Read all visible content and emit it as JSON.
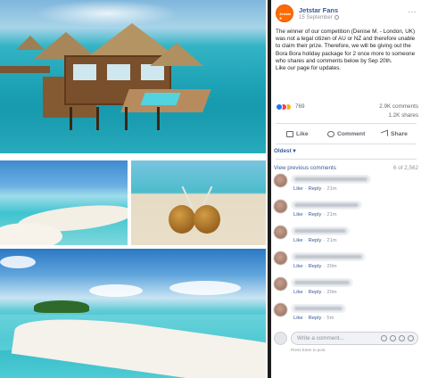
{
  "post": {
    "page_name": "Jetstar Fans",
    "avatar_text": "Jetstar ✈",
    "date": "15 September",
    "more": "···",
    "text": "The winner of our competition (Denise M. - London, UK) was not a legal citizen of AU or NZ and therefore unable to claim their prize. Therefore, we will be giving out the Bora Bora holiday package for 2 once more to someone who shares and comments below by Sep 20th.",
    "text_2": "Like our page for updates.",
    "reaction_count": "769",
    "comments_count": "2.9K comments",
    "shares_count": "1.2K shares"
  },
  "actions": {
    "like": "Like",
    "comment": "Comment",
    "share": "Share"
  },
  "comments_section": {
    "sort_label": "Oldest ▾",
    "view_previous": "View previous comments",
    "count_of": "6 of 2,562",
    "like_label": "Like",
    "reply_label": "Reply",
    "items": [
      {
        "time": "21m"
      },
      {
        "time": "21m"
      },
      {
        "time": "21m"
      },
      {
        "time": "20m"
      },
      {
        "time": "20m"
      },
      {
        "time": "5m"
      }
    ]
  },
  "composer": {
    "placeholder": "Write a comment...",
    "hint": "Press Enter to post."
  },
  "colors": {
    "fb_link": "#385898",
    "brand_orange": "#ff6b00",
    "divider": "#1c1c1c"
  }
}
